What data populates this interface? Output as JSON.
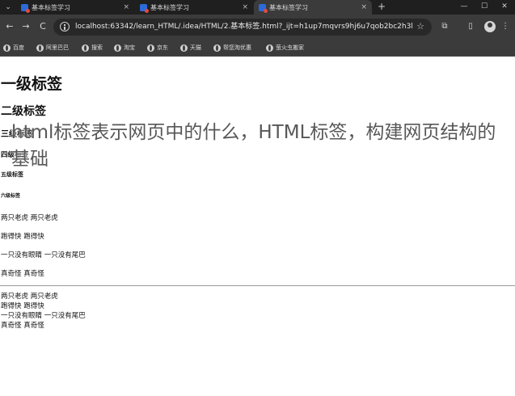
{
  "browser": {
    "tabs": [
      {
        "title": "基本标签学习",
        "close": "×"
      },
      {
        "title": "基本标签学习",
        "close": "×"
      },
      {
        "title": "基本标签学习",
        "close": "×"
      }
    ],
    "new_tab": "+",
    "window_controls": {
      "minimize": "—",
      "maximize": "☐",
      "close": "✕"
    },
    "nav": {
      "back": "←",
      "forward": "→",
      "reload": "C"
    },
    "url": "localhost:63342/learn_HTML/.idea/HTML/2.基本标签.html?_ijt=h1up7mqvrs9hj6u7qob2bc2h3l",
    "icons": {
      "star": "☆",
      "extensions": "⧉",
      "sidebar": "▯",
      "menu": "⋮",
      "tab_menu": "⌄"
    },
    "bookmarks": [
      "百度",
      "阿里巴巴",
      "搜索",
      "淘宝",
      "京东",
      "天猫",
      "帮您淘优惠",
      "萤火虫搬家"
    ]
  },
  "page": {
    "h1": "一级标签",
    "h2": "二级标签",
    "h3": "三级标签",
    "h4": "四级标签",
    "h5": "五级标签",
    "h6": "六级标签",
    "paragraphs": [
      "两只老虎 两只老虎",
      "跑得快 跑得快",
      "一只没有眼睛 一只没有尾巴",
      "真奇怪 真奇怪"
    ],
    "plain_lines": [
      "两只老虎 两只老虎",
      "跑得快 跑得快",
      "一只没有眼睛 一只没有尾巴",
      "真奇怪 真奇怪"
    ]
  },
  "watermark": "html标签表示网页中的什么，HTML标签，构建网页结构的基础"
}
